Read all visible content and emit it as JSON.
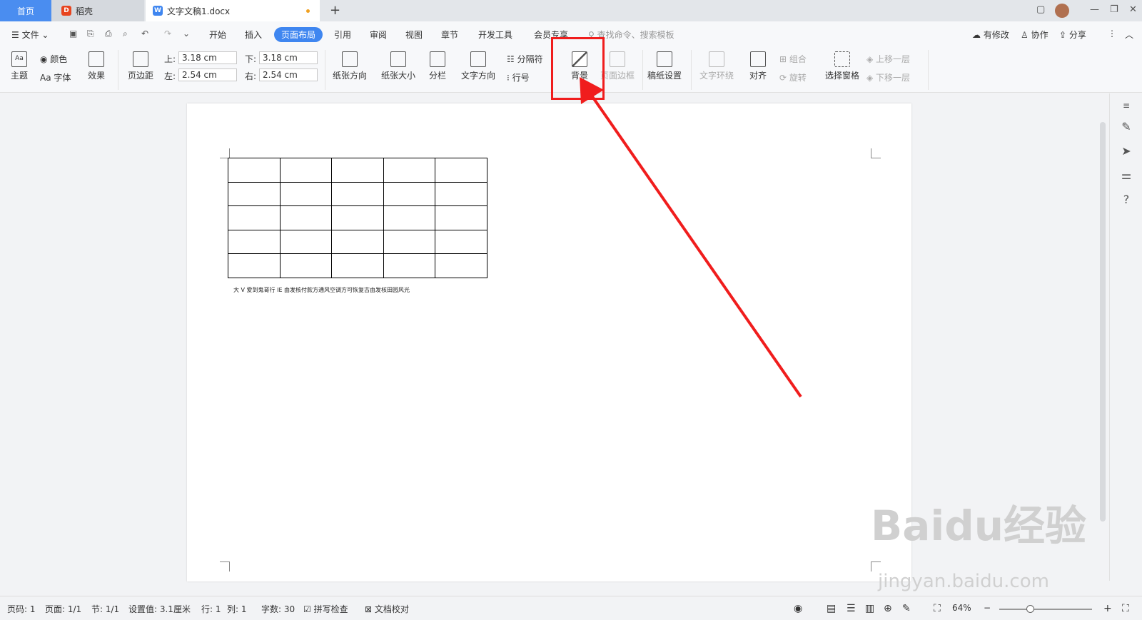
{
  "tabs": {
    "home": "首页",
    "daoke": "稻壳",
    "doc": "文字文稿1.docx"
  },
  "menu": {
    "file": "文件",
    "items": [
      "开始",
      "插入",
      "页面布局",
      "引用",
      "审阅",
      "视图",
      "章节",
      "开发工具",
      "会员专享"
    ],
    "active": "页面布局",
    "search_placeholder": "查找命令、搜索模板",
    "right": {
      "modified": "有修改",
      "collab": "协作",
      "share": "分享"
    }
  },
  "ribbon": {
    "theme": "主题",
    "color": "颜色",
    "font": "Aa 字体",
    "effect": "效果",
    "margins": "页边距",
    "top_label": "上:",
    "top_value": "3.18 cm",
    "bottom_label": "下:",
    "bottom_value": "3.18 cm",
    "left_label": "左:",
    "left_value": "2.54 cm",
    "right_label": "右:",
    "right_value": "2.54 cm",
    "orientation": "纸张方向",
    "size": "纸张大小",
    "columns": "分栏",
    "text_direction": "文字方向",
    "separator": "分隔符",
    "line_numbers": "行号",
    "background": "背景",
    "page_border": "页面边框",
    "manuscript": "稿纸设置",
    "wrap": "文字环绕",
    "align": "对齐",
    "group": "组合",
    "rotate": "旋转",
    "selection_pane": "选择窗格",
    "bring_forward": "上移一层",
    "send_backward": "下移一层"
  },
  "document": {
    "text": "大 V 爱到鬼哥行 IE 由发核付款方通风空调方可恢复古由发核田园风光",
    "table_rows": 5,
    "table_cols": 5
  },
  "status": {
    "page_code": "页码: 1",
    "pages": "页面: 1/1",
    "section": "节: 1/1",
    "setting": "设置值: 3.1厘米",
    "row": "行: 1",
    "col": "列: 1",
    "words": "字数: 30",
    "spell": "拼写检查",
    "proof": "文档校对",
    "zoom": "64%"
  },
  "watermark": {
    "main": "Baidu经验",
    "sub": "jingyan.baidu.com"
  },
  "colors": {
    "accent": "#3f86f0",
    "highlight": "#f01d1d"
  }
}
